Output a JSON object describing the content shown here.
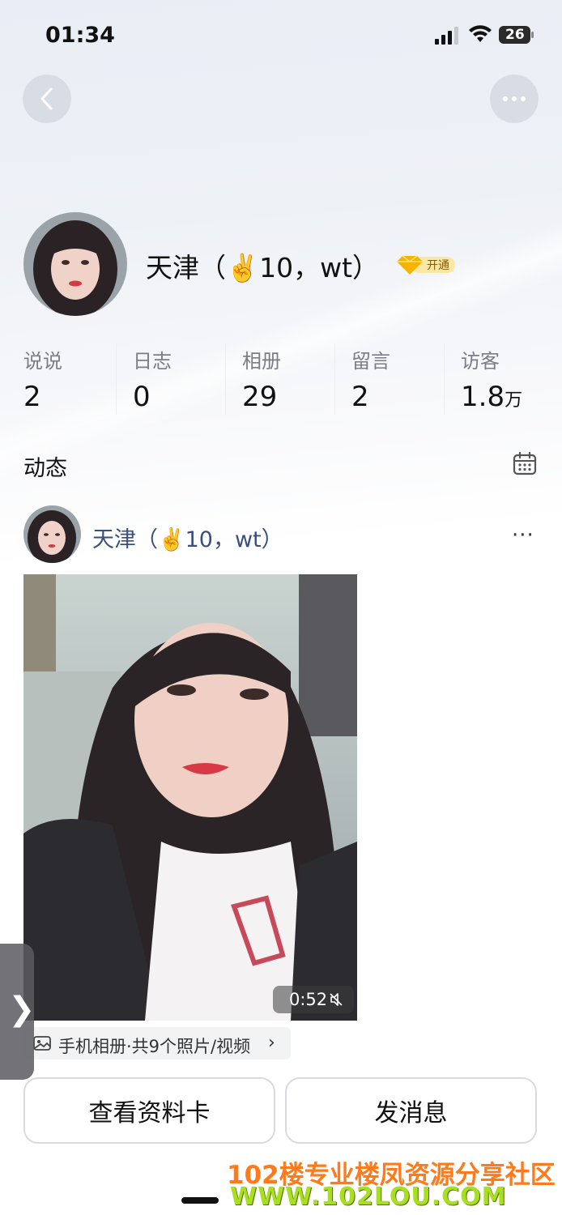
{
  "status_bar": {
    "time": "01:34",
    "battery": "26"
  },
  "header": {
    "back_icon": "chevron-left-icon",
    "more_icon": "more-horizontal-icon"
  },
  "profile": {
    "name": "天津（✌️10，wt）",
    "vip_badge": "开通",
    "vip_icon": "diamond-icon"
  },
  "stats": [
    {
      "label": "说说",
      "value": "2",
      "unit": ""
    },
    {
      "label": "日志",
      "value": "0",
      "unit": ""
    },
    {
      "label": "相册",
      "value": "29",
      "unit": ""
    },
    {
      "label": "留言",
      "value": "2",
      "unit": ""
    },
    {
      "label": "访客",
      "value": "1.8",
      "unit": "万"
    }
  ],
  "feed": {
    "title": "动态",
    "calendar_icon": "calendar-icon",
    "post": {
      "author": "天津（✌️10，wt）",
      "more": "···",
      "video_duration": "0:52",
      "album_text": "手机相册·共9个照片/视频",
      "album_arrow": "›"
    }
  },
  "side_tab": {
    "label": "❯"
  },
  "actions": {
    "view_card": "查看资料卡",
    "send_message": "发消息"
  },
  "watermark": {
    "line1": "102楼专业楼凤资源分享社区",
    "line2": "WWW.102LOU.COM"
  },
  "colors": {
    "name_link": "#3a4f7d",
    "watermark_orange": "#ff7a1a",
    "watermark_green": "#a8e020"
  }
}
